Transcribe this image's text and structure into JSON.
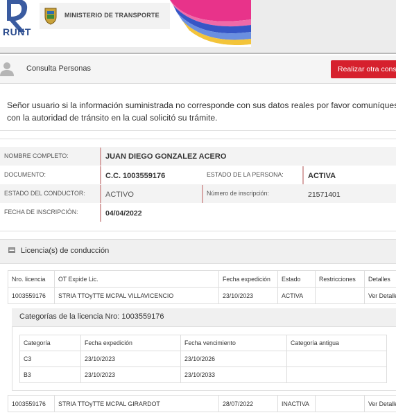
{
  "header": {
    "logo_text": "RUNT",
    "ministry_text": "MINISTERIO DE TRANSPORTE"
  },
  "consulta": {
    "title": "Consulta Personas",
    "button_label": "Realizar otra consulta"
  },
  "notice": {
    "line1": "Señor usuario si la información suministrada no corresponde con sus datos reales por favor comuníquese",
    "line2": "con la autoridad de tránsito en la cual solicitó su trámite."
  },
  "person": {
    "nombre_label": "NOMBRE COMPLETO:",
    "nombre_value": "JUAN DIEGO GONZALEZ ACERO",
    "documento_label": "DOCUMENTO:",
    "documento_value": "C.C. 1003559176",
    "estado_persona_label": "ESTADO DE LA PERSONA:",
    "estado_persona_value": "ACTIVA",
    "estado_conductor_label": "ESTADO DEL CONDUCTOR:",
    "estado_conductor_value": "ACTIVO",
    "inscripcion_num_label": "Número de inscripción:",
    "inscripcion_num_value": "21571401",
    "fecha_inscripcion_label": "FECHA DE INSCRIPCIÓN:",
    "fecha_inscripcion_value": "04/04/2022"
  },
  "licencias": {
    "panel_title": "Licencia(s) de conducción",
    "columns": [
      "Nro. licencia",
      "OT Expide Lic.",
      "Fecha expedición",
      "Estado",
      "Restricciones",
      "Detalles"
    ],
    "rows": [
      {
        "nro": "1003559176",
        "ot": "STRIA TTOyTTE MCPAL VILLAVICENCIO",
        "fecha": "23/10/2023",
        "estado": "ACTIVA",
        "restricciones": "",
        "detalle": "Ver Detalle"
      },
      {
        "nro": "1003559176",
        "ot": "STRIA TTOyTTE MCPAL GIRARDOT",
        "fecha": "28/07/2022",
        "estado": "INACTIVA",
        "restricciones": "",
        "detalle": "Ver Detalle"
      }
    ],
    "categorias": {
      "title": "Categorías de la licencia Nro: 1003559176",
      "columns": [
        "Categoría",
        "Fecha expedición",
        "Fecha vencimiento",
        "Categoría antigua"
      ],
      "rows": [
        {
          "categoria": "C3",
          "expedicion": "23/10/2023",
          "vencimiento": "23/10/2026",
          "antigua": ""
        },
        {
          "categoria": "B3",
          "expedicion": "23/10/2023",
          "vencimiento": "23/10/2033",
          "antigua": ""
        }
      ]
    }
  },
  "colors": {
    "accent_red": "#d6202d",
    "runt_blue": "#2a4b8d"
  }
}
